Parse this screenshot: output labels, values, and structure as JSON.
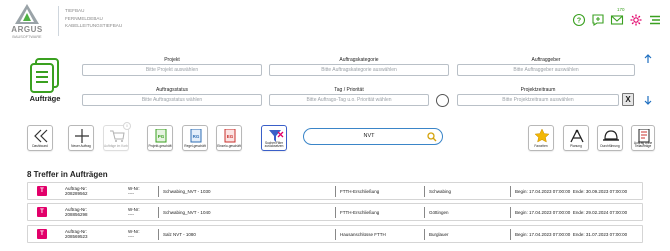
{
  "header": {
    "logo_text": "ARGUS",
    "logo_subtext": "BAUSOFTWARE",
    "company_lines": [
      "TIEFBAU",
      "FERNMELDEBAU",
      "KABELLEITUNGSTIEFBAU"
    ],
    "icons": [
      "help-icon",
      "add-comment-icon",
      "mail-icon",
      "settings-icon",
      "menu-icon"
    ],
    "mail_count": "170",
    "accent_color": "#3aa020"
  },
  "panel": {
    "title": "Aufträge",
    "fields": {
      "projekt": {
        "label": "Projekt",
        "placeholder": "Bitte Projekt auswählen"
      },
      "auftragskategorie": {
        "label": "Auftragskategorie",
        "placeholder": "Bitte Auftragskategorie auswählen"
      },
      "auftraggeber": {
        "label": "Auftraggeber",
        "placeholder": "Bitte Auftraggeber auswählen"
      },
      "auftragsstatus": {
        "label": "Auftragsstatus",
        "placeholder": "Bitte Auftragsstatus wählen"
      },
      "tag_prioritaet": {
        "label": "Tag / Priorität",
        "placeholder": "Bitte Auftrags-Tag u.o. Priorität wählen"
      },
      "projektzeitraum": {
        "label": "Projektzeitraum",
        "placeholder": "Bitte Projektzeitraum auswählen"
      }
    },
    "clear_label": "X"
  },
  "toolbar": {
    "dashboard": "Dashboard",
    "new_order": "Neuer Auftrag",
    "orders_cart": "Aufträge im Korb",
    "orders_cart_count": "0",
    "projects": "Projekt-geschäft",
    "rule": "Regel-geschäft",
    "single": "Einzelo-geschäft",
    "reset_filters": "Sucher/Filter zurücksetzen",
    "search_value": "NVT",
    "favorites": "Favoriten",
    "planning": "Planung",
    "completion": "Durchführung",
    "no_order": "Auftrag ohne Teilaufträge"
  },
  "results": {
    "title": "8 Treffer in Aufträgen",
    "badge": "T",
    "badge_color": "#e2006a",
    "rows": [
      {
        "nr_label": "Auftrag-Nr:",
        "nr": "208289562",
        "w_label": "W-Nr:",
        "w": "----",
        "name": "Schwabing_NVT - 1030",
        "kategorie": "FTTH-Erschließung",
        "ort": "Schwabing",
        "begin": "Begin: 17.04.2023 07:00:00",
        "ende": "Ende: 30.09.2023 07:00:00"
      },
      {
        "nr_label": "Auftrag-Nr:",
        "nr": "208856298",
        "w_label": "W-Nr:",
        "w": "----",
        "name": "Schwabing_NVT - 1040",
        "kategorie": "FTTH-Erschließung",
        "ort": "Göttingen",
        "begin": "Begin: 17.04.2023 07:00:00",
        "ende": "Ende: 29.02.2024 07:00:00"
      },
      {
        "nr_label": "Auftrag-Nr:",
        "nr": "208569523",
        "w_label": "W-Nr:",
        "w": "----",
        "name": "Salz NVT - 1080",
        "kategorie": "Hausanschlüsse FTTH",
        "ort": "Burglauer",
        "begin": "Begin: 17.04.2023 07:00:00",
        "ende": "Ende: 31.07.2023 07:00:00"
      }
    ]
  }
}
